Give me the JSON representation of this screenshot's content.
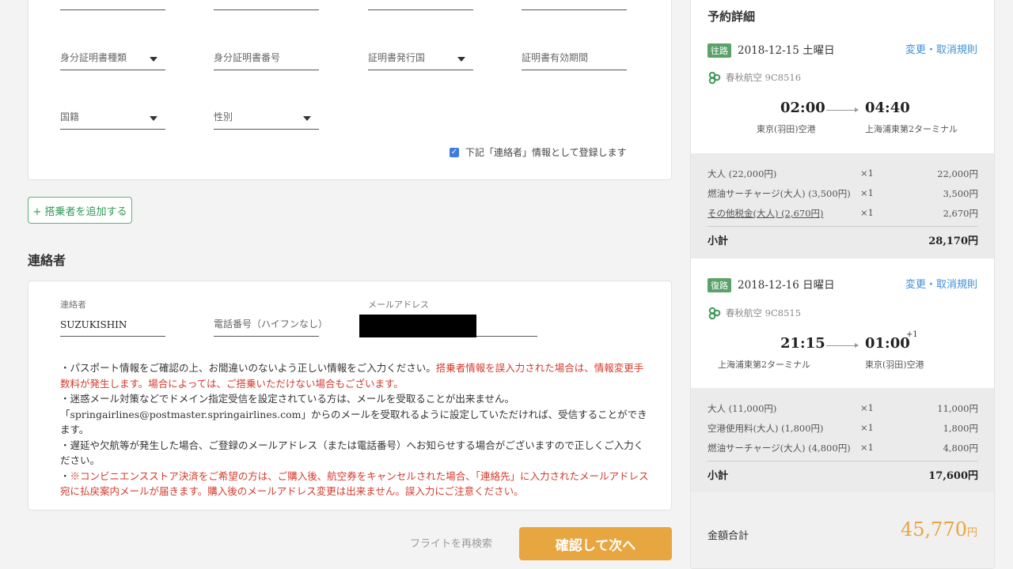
{
  "passenger_form": {
    "fields": [
      {
        "label": "身分証明書種類",
        "dropdown": true
      },
      {
        "label": "身分証明書番号",
        "dropdown": false
      },
      {
        "label": "証明書発行国",
        "dropdown": true
      },
      {
        "label": "証明書有効期間",
        "dropdown": false
      },
      {
        "label": "国籍",
        "dropdown": true
      },
      {
        "label": "性別",
        "dropdown": true
      }
    ],
    "register_contact_checkbox": {
      "label": "下記「連絡者」情報として登録します",
      "checked": true
    },
    "add_passenger_button": "+ 搭乗者を追加する"
  },
  "contact": {
    "heading": "連絡者",
    "name_label": "連絡者",
    "name_value": "SUZUKISHIN",
    "phone_placeholder": "電話番号（ハイフンなし）",
    "email_label": "メールアドレス",
    "notes": [
      {
        "normal": "・パスポート情報をご確認の上、お間違いのないよう正しい情報をご入力ください。",
        "red": "搭乗者情報を誤入力された場合は、情報変更手数料が発生します。場合によっては、ご搭乗いただけない場合もございます。"
      },
      {
        "normal": "・迷惑メール対策などでドメイン指定受信を設定されている方は、メールを受取ることが出来ません。「springairlines@postmaster.springairlines.com」からのメールを受取れるように設定していただければ、受信することができます。",
        "red": ""
      },
      {
        "normal": "・遅延や欠航等が発生した場合、ご登録のメールアドレス（または電話番号）へお知らせする場合がございますので正しくご入力ください。",
        "red": ""
      },
      {
        "normal": "・",
        "red": "※コンビニエンスストア決済をご希望の方は、ご購入後、航空券をキャンセルされた場合、「連絡先」に入力されたメールアドレス宛に払戻案内メールが届きます。購入後のメールアドレス変更は出来ません。誤入力にご注意ください。"
      }
    ]
  },
  "actions": {
    "research": "フライトを再検索",
    "confirm": "確認して次へ"
  },
  "summary": {
    "title": "予約詳細",
    "outbound": {
      "tag": "往路",
      "date": "2018-12-15 土曜日",
      "change_link": "変更・取消規則",
      "airline": "春秋航空 9C8516",
      "dep_time": "02:00",
      "arr_time": "04:40",
      "dep_airport": "東京(羽田)空港",
      "arr_airport": "上海浦東第2ターミナル",
      "fares": [
        {
          "name": "大人 (22,000円)",
          "qty": "×1",
          "price": "22,000円",
          "underline": false
        },
        {
          "name": "燃油サーチャージ(大人) (3,500円)",
          "qty": "×1",
          "price": "3,500円",
          "underline": false
        },
        {
          "name": "その他税金(大人) (2,670円)",
          "qty": "×1",
          "price": "2,670円",
          "underline": true
        }
      ],
      "subtotal_label": "小計",
      "subtotal": "28,170円"
    },
    "return": {
      "tag": "復路",
      "date": "2018-12-16 日曜日",
      "change_link": "変更・取消規則",
      "airline": "春秋航空 9C8515",
      "dep_time": "21:15",
      "arr_time": "01:00",
      "next_day": "+1",
      "dep_airport": "上海浦東第2ターミナル",
      "arr_airport": "東京(羽田)空港",
      "fares": [
        {
          "name": "大人 (11,000円)",
          "qty": "×1",
          "price": "11,000円",
          "underline": false
        },
        {
          "name": "空港使用料(大人) (1,800円)",
          "qty": "×1",
          "price": "1,800円",
          "underline": false
        },
        {
          "name": "燃油サーチャージ(大人) (4,800円)",
          "qty": "×1",
          "price": "4,800円",
          "underline": false
        }
      ],
      "subtotal_label": "小計",
      "subtotal": "17,600円"
    },
    "total_label": "金額合計",
    "total_amount": "45,770",
    "total_unit": "円",
    "colors": {
      "accent": "#e8a640",
      "link": "#3f8fd6",
      "tag": "#5aa16a",
      "warning": "#d43a2c"
    }
  }
}
